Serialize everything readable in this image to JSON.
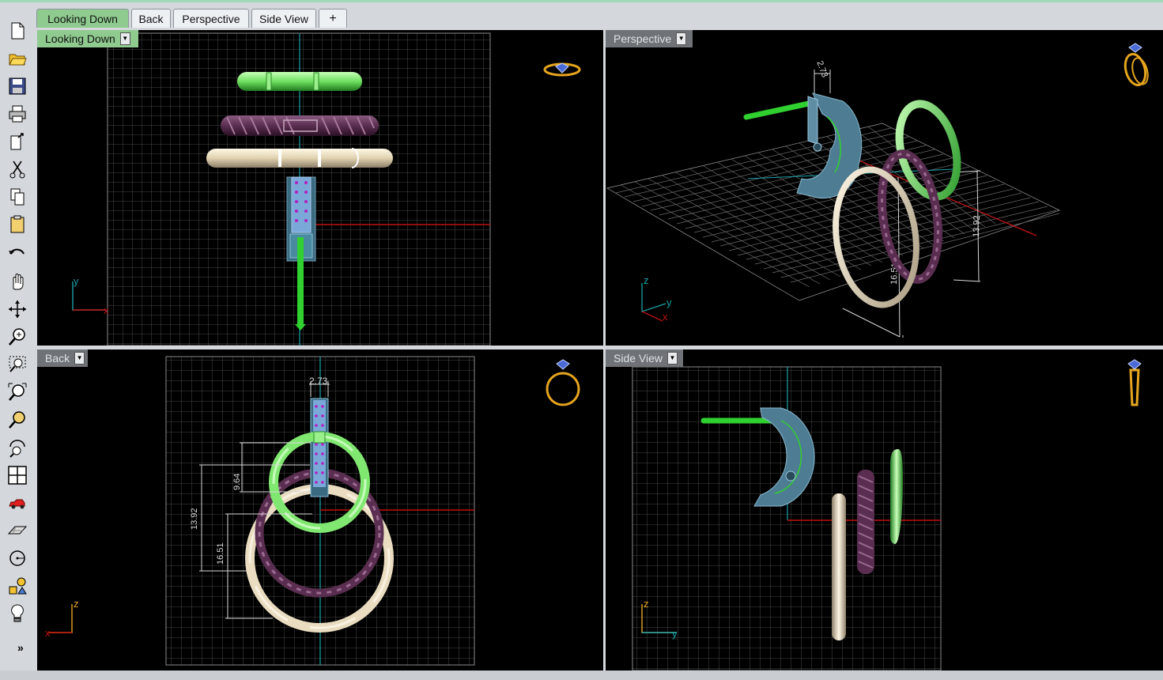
{
  "tabs": [
    {
      "label": "Looking Down",
      "active": true
    },
    {
      "label": "Back",
      "active": false
    },
    {
      "label": "Perspective",
      "active": false
    },
    {
      "label": "Side View",
      "active": false
    }
  ],
  "add_tab_icon": "plus-icon",
  "toolbar": {
    "icons": [
      "new-file-icon",
      "open-folder-icon",
      "save-icon",
      "print-icon",
      "export-icon",
      "cut-icon",
      "copy-icon",
      "paste-icon",
      "undo-icon",
      "pan-hand-icon",
      "rotate-view-icon",
      "zoom-in-icon",
      "zoom-window-icon",
      "zoom-extents-icon",
      "zoom-selected-icon",
      "rotate-camera-icon",
      "four-viewports-icon",
      "car-render-icon",
      "plane-icon",
      "circle-icon",
      "shapes-icon",
      "lightbulb-icon"
    ],
    "more_label": "»"
  },
  "viewports": {
    "top_left": {
      "label": "Looking Down",
      "axis_x": "x",
      "axis_y": "y"
    },
    "top_right": {
      "label": "Perspective",
      "axis_x": "x",
      "axis_y": "y",
      "axis_z": "z",
      "dim_a": "2.73",
      "dim_b": "13.92",
      "dim_c": "16.51"
    },
    "bottom_left": {
      "label": "Back",
      "axis_x": "x",
      "axis_z": "z",
      "dim_top": "2.73",
      "dim_1": "9.64",
      "dim_2": "13.92",
      "dim_3": "16.51"
    },
    "bottom_right": {
      "label": "Side View",
      "axis_y": "y",
      "axis_z": "z"
    }
  },
  "colors": {
    "active_tab": "#8fca8f",
    "viewport_bg": "#000000",
    "green_ring": "#80e870",
    "purple_ring": "#5a2e50",
    "cream_ring": "#e9dcc0",
    "steel": "#5f8aa0",
    "gold": "#e6a51e"
  }
}
